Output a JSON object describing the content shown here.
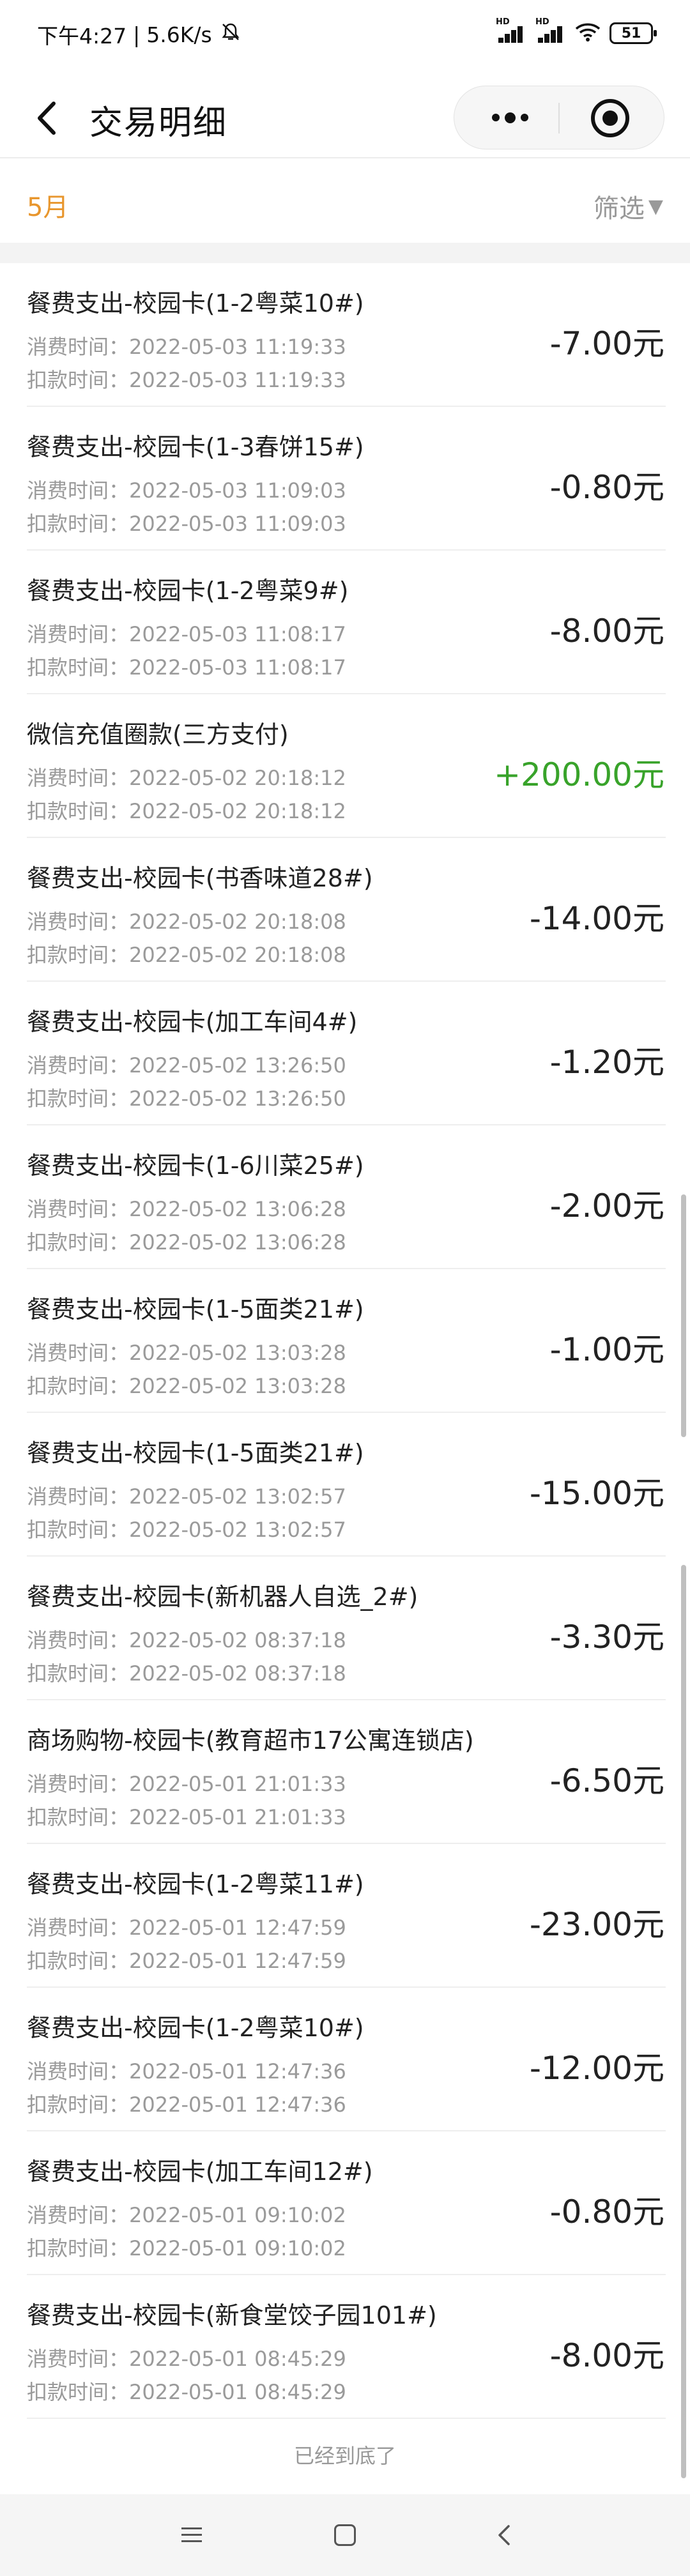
{
  "status_bar": {
    "time": "下午4:27",
    "network_speed": "5.6K/s",
    "signal_tag_1": "HD",
    "signal_tag_2": "HD",
    "battery": "51"
  },
  "nav": {
    "title": "交易明细"
  },
  "filter_bar": {
    "month": "5月",
    "filter_label": "筛选",
    "filter_arrow": "▼"
  },
  "labels": {
    "consume_time": "消费时间：",
    "deduct_time": "扣款时间："
  },
  "transactions": [
    {
      "title": "餐费支出-校园卡(1-2粤菜10#)",
      "consume_time": "2022-05-03 11:19:33",
      "deduct_time": "2022-05-03 11:19:33",
      "amount": "-7.00元",
      "type": "expense"
    },
    {
      "title": "餐费支出-校园卡(1-3春饼15#)",
      "consume_time": "2022-05-03 11:09:03",
      "deduct_time": "2022-05-03 11:09:03",
      "amount": "-0.80元",
      "type": "expense"
    },
    {
      "title": "餐费支出-校园卡(1-2粤菜9#)",
      "consume_time": "2022-05-03 11:08:17",
      "deduct_time": "2022-05-03 11:08:17",
      "amount": "-8.00元",
      "type": "expense"
    },
    {
      "title": "微信充值圈款(三方支付)",
      "consume_time": "2022-05-02 20:18:12",
      "deduct_time": "2022-05-02 20:18:12",
      "amount": "+200.00元",
      "type": "income"
    },
    {
      "title": "餐费支出-校园卡(书香味道28#)",
      "consume_time": "2022-05-02 20:18:08",
      "deduct_time": "2022-05-02 20:18:08",
      "amount": "-14.00元",
      "type": "expense"
    },
    {
      "title": "餐费支出-校园卡(加工车间4#)",
      "consume_time": "2022-05-02 13:26:50",
      "deduct_time": "2022-05-02 13:26:50",
      "amount": "-1.20元",
      "type": "expense"
    },
    {
      "title": "餐费支出-校园卡(1-6川菜25#)",
      "consume_time": "2022-05-02 13:06:28",
      "deduct_time": "2022-05-02 13:06:28",
      "amount": "-2.00元",
      "type": "expense"
    },
    {
      "title": "餐费支出-校园卡(1-5面类21#)",
      "consume_time": "2022-05-02 13:03:28",
      "deduct_time": "2022-05-02 13:03:28",
      "amount": "-1.00元",
      "type": "expense"
    },
    {
      "title": "餐费支出-校园卡(1-5面类21#)",
      "consume_time": "2022-05-02 13:02:57",
      "deduct_time": "2022-05-02 13:02:57",
      "amount": "-15.00元",
      "type": "expense"
    },
    {
      "title": "餐费支出-校园卡(新机器人自选_2#)",
      "consume_time": "2022-05-02 08:37:18",
      "deduct_time": "2022-05-02 08:37:18",
      "amount": "-3.30元",
      "type": "expense"
    },
    {
      "title": "商场购物-校园卡(教育超市17公寓连锁店)",
      "consume_time": "2022-05-01 21:01:33",
      "deduct_time": "2022-05-01 21:01:33",
      "amount": "-6.50元",
      "type": "expense"
    },
    {
      "title": "餐费支出-校园卡(1-2粤菜11#)",
      "consume_time": "2022-05-01 12:47:59",
      "deduct_time": "2022-05-01 12:47:59",
      "amount": "-23.00元",
      "type": "expense"
    },
    {
      "title": "餐费支出-校园卡(1-2粤菜10#)",
      "consume_time": "2022-05-01 12:47:36",
      "deduct_time": "2022-05-01 12:47:36",
      "amount": "-12.00元",
      "type": "expense"
    },
    {
      "title": "餐费支出-校园卡(加工车间12#)",
      "consume_time": "2022-05-01 09:10:02",
      "deduct_time": "2022-05-01 09:10:02",
      "amount": "-0.80元",
      "type": "expense"
    },
    {
      "title": "餐费支出-校园卡(新食堂饺子园101#)",
      "consume_time": "2022-05-01 08:45:29",
      "deduct_time": "2022-05-01 08:45:29",
      "amount": "-8.00元",
      "type": "expense"
    }
  ],
  "footer": {
    "end_text": "已经到底了"
  },
  "colors": {
    "month_accent": "#e8962d",
    "income_green": "#38a32a",
    "expense_text": "#222222",
    "secondary_text": "#9a9a9a"
  },
  "icons": [
    "back-icon",
    "more-icon",
    "target-icon",
    "mute-bell-icon",
    "wifi-icon",
    "battery-icon",
    "menu-icon",
    "home-icon",
    "back-nav-icon"
  ]
}
